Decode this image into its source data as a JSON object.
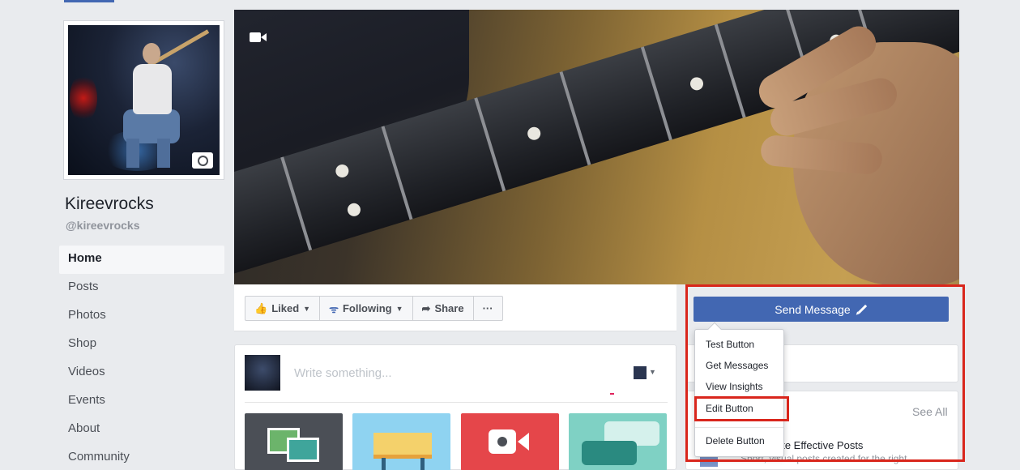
{
  "page": {
    "name": "Kireevrocks",
    "handle": "@kireevrocks"
  },
  "nav": {
    "items": [
      {
        "label": "Home",
        "active": true
      },
      {
        "label": "Posts"
      },
      {
        "label": "Photos"
      },
      {
        "label": "Shop"
      },
      {
        "label": "Videos"
      },
      {
        "label": "Events"
      },
      {
        "label": "About"
      },
      {
        "label": "Community"
      }
    ]
  },
  "actions": {
    "liked": "Liked",
    "following": "Following",
    "share": "Share",
    "more": "···"
  },
  "composer": {
    "placeholder": "Write something..."
  },
  "cta": {
    "label": "Send Message",
    "menu": [
      "Test Button",
      "Get Messages",
      "View Insights",
      "Edit Button",
      "Delete Button"
    ]
  },
  "sidebar_card": {
    "see_all": "See All",
    "tip_title": "ate Effective Posts",
    "tip_sub": "Short, visual posts created for the right"
  },
  "colors": {
    "brand": "#4267b2",
    "highlight": "#d9261c"
  }
}
